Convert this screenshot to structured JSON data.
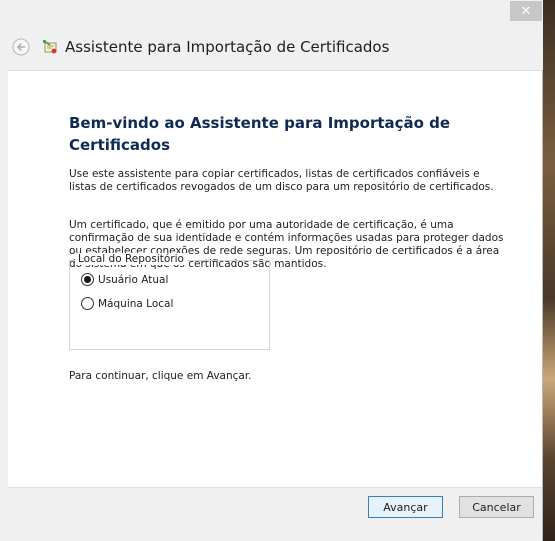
{
  "window": {
    "title": "Assistente para Importação de Certificados",
    "close_glyph": "✕"
  },
  "icons": {
    "back": "back-arrow-icon",
    "wizard": "certificate-wizard-icon",
    "close": "close-icon"
  },
  "content": {
    "heading": "Bem-vindo ao Assistente para Importação de Certificados",
    "paragraph1": "Use este assistente para copiar certificados, listas de certificados confiáveis e listas de certificados revogados de um disco para um repositório de certificados.",
    "paragraph2": "Um certificado, que é emitido por uma autoridade de certificação, é uma confirmação de sua identidade e contém informações usadas para proteger dados ou estabelecer conexões de rede seguras. Um repositório de certificados é a área do sistema em que os certificados são mantidos.",
    "store_location": {
      "legend": "Local do Repositório",
      "options": [
        {
          "label": "Usuário Atual",
          "selected": true
        },
        {
          "label": "Máquina Local",
          "selected": false
        }
      ]
    },
    "continue_hint": "Para continuar, clique em Avançar."
  },
  "footer": {
    "next_label": "Avançar",
    "cancel_label": "Cancelar"
  },
  "colors": {
    "heading": "#0f2a55",
    "accent_border": "#3c7fb1"
  }
}
